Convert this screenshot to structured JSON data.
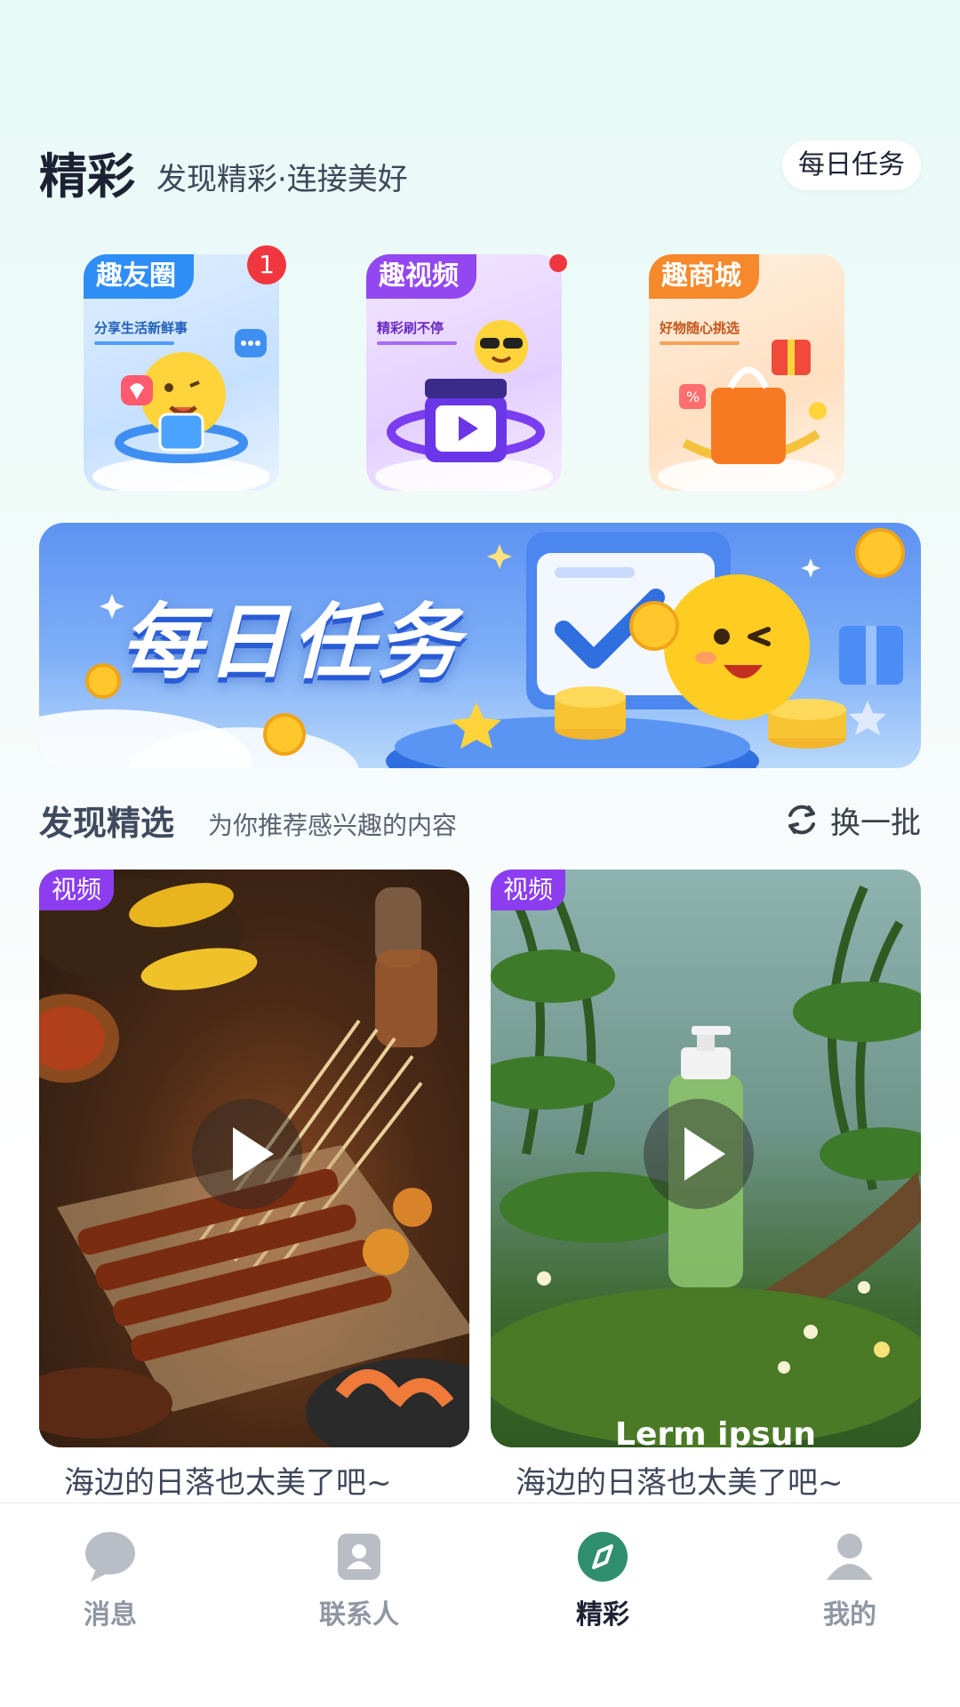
{
  "header": {
    "title": "精彩",
    "subtitle": "发现精彩·连接美好",
    "daily_task_chip": "每日任务"
  },
  "features": [
    {
      "tag": "趣友圈",
      "desc": "分享生活新鲜事",
      "badge": "1",
      "color": "#2f8ef5"
    },
    {
      "tag": "趣视频",
      "desc": "精彩刷不停",
      "color": "#9347f0"
    },
    {
      "tag": "趣商城",
      "desc": "好物随心挑选",
      "color": "#f5892b"
    }
  ],
  "banner": {
    "title": "每日任务"
  },
  "discover": {
    "title": "发现精选",
    "subtitle": "为你推荐感兴趣的内容",
    "refresh_label": "换一批"
  },
  "cards": [
    {
      "tag": "视频",
      "caption": "海边的日落也太美了吧~"
    },
    {
      "tag": "视频",
      "caption": "海边的日落也太美了吧~",
      "overlay_text": "Lerm ipsun"
    }
  ],
  "tabbar": {
    "items": [
      {
        "label": "消息",
        "icon": "message-bubble-icon"
      },
      {
        "label": "联系人",
        "icon": "contacts-icon"
      },
      {
        "label": "精彩",
        "icon": "compass-icon",
        "active": true
      },
      {
        "label": "我的",
        "icon": "person-icon"
      }
    ]
  },
  "colors": {
    "accent": "#2f8e6e",
    "badge": "#f0373f",
    "video_tag": "#8c3df0"
  }
}
